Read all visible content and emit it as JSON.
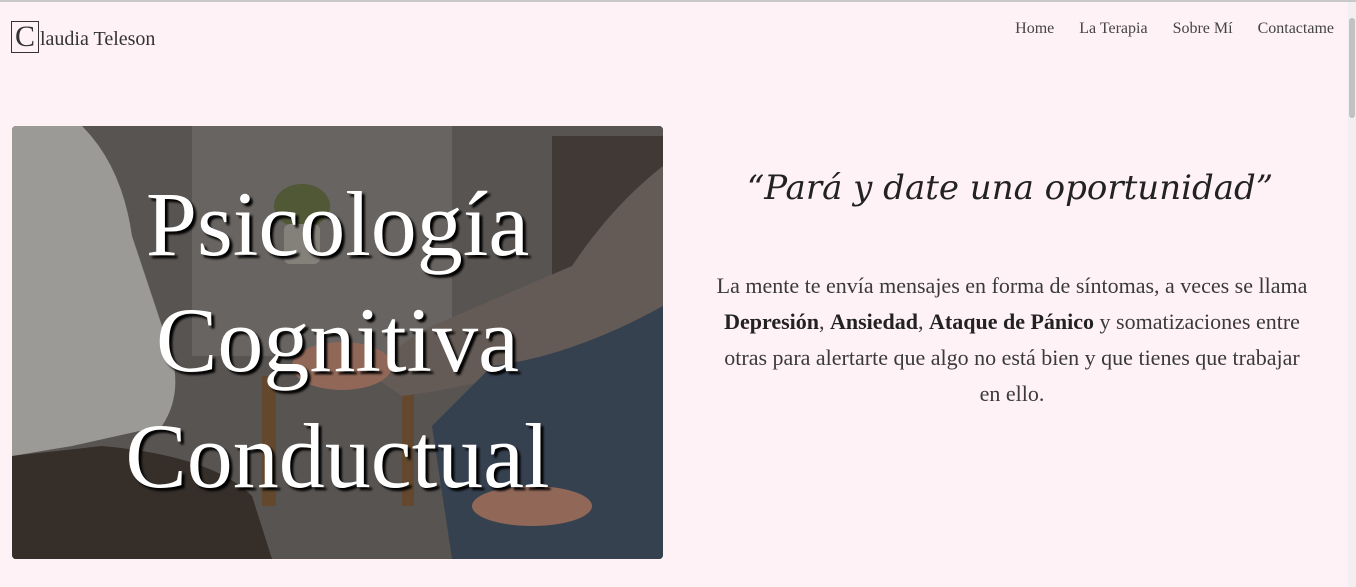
{
  "logo": {
    "initial": "C",
    "rest": "laudia Teleson"
  },
  "nav": {
    "items": [
      {
        "label": "Home"
      },
      {
        "label": "La Terapia"
      },
      {
        "label": "Sobre Mí"
      },
      {
        "label": "Contactame"
      }
    ]
  },
  "hero": {
    "title_lines": [
      "Psicología",
      "Cognitiva",
      "Conductual"
    ]
  },
  "quote": "“Pará y date una oportunidad”",
  "description": {
    "part1": "La mente te envía mensajes en forma de síntomas, a veces se llama ",
    "bold1": "Depresión",
    "sep1": ", ",
    "bold2": "Ansiedad",
    "sep2": ", ",
    "bold3": "Ataque de Pánico",
    "part2": " y somatizaciones entre otras para alertarte que algo no está bien y que tienes que trabajar en ello."
  }
}
